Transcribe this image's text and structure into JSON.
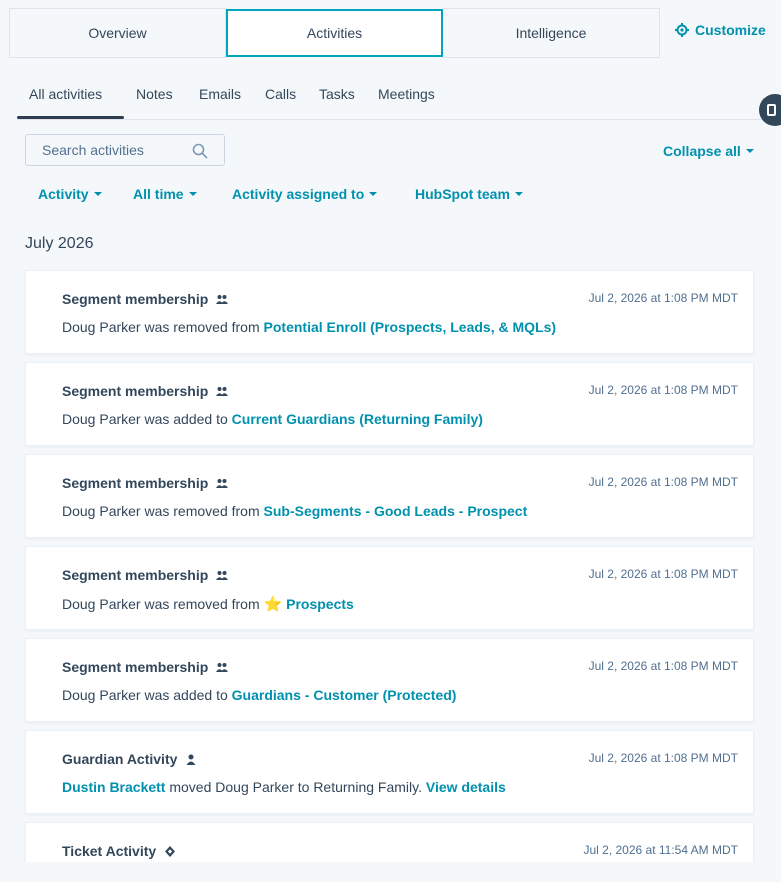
{
  "top_tabs": [
    "Overview",
    "Activities",
    "Intelligence"
  ],
  "customize_label": "Customize",
  "sub_tabs": [
    "All activities",
    "Notes",
    "Emails",
    "Calls",
    "Tasks",
    "Meetings"
  ],
  "search": {
    "placeholder": "Search activities"
  },
  "collapse_label": "Collapse all",
  "filters": [
    "Activity",
    "All time",
    "Activity assigned to",
    "HubSpot team"
  ],
  "month_heading": "July 2026",
  "cards": [
    {
      "title": "Segment membership",
      "time": "Jul 2, 2026 at 1:08 PM MDT",
      "prefix": "Doug Parker was removed from ",
      "link": "Potential Enroll (Prospects, Leads, & MQLs)"
    },
    {
      "title": "Segment membership",
      "time": "Jul 2, 2026 at 1:08 PM MDT",
      "prefix": "Doug Parker was added to ",
      "link": "Current Guardians (Returning Family)"
    },
    {
      "title": "Segment membership",
      "time": "Jul 2, 2026 at 1:08 PM MDT",
      "prefix": "Doug Parker was removed from ",
      "link": "Sub-Segments - Good Leads - Prospect"
    },
    {
      "title": "Segment membership",
      "time": "Jul 2, 2026 at 1:08 PM MDT",
      "prefix": "Doug Parker was removed from ",
      "star": "⭐",
      "link": "Prospects"
    },
    {
      "title": "Segment membership",
      "time": "Jul 2, 2026 at 1:08 PM MDT",
      "prefix": "Doug Parker was added to ",
      "link": "Guardians - Customer (Protected)"
    },
    {
      "title": "Guardian Activity",
      "time": "Jul 2, 2026 at 1:08 PM MDT",
      "actor": "Dustin Brackett",
      "middle": " moved Doug Parker to Returning Family. ",
      "link": "View details"
    },
    {
      "title": "Ticket Activity",
      "time": "Jul 2, 2026 at 11:54 AM MDT"
    }
  ],
  "icons": {
    "segment": "people-icon",
    "guardian": "person-icon",
    "ticket": "ticket-icon",
    "customize": "gear-icon",
    "search": "search-icon"
  },
  "colors": {
    "accent": "#0091ae",
    "active_border": "#00a4bd",
    "text": "#33475b"
  }
}
